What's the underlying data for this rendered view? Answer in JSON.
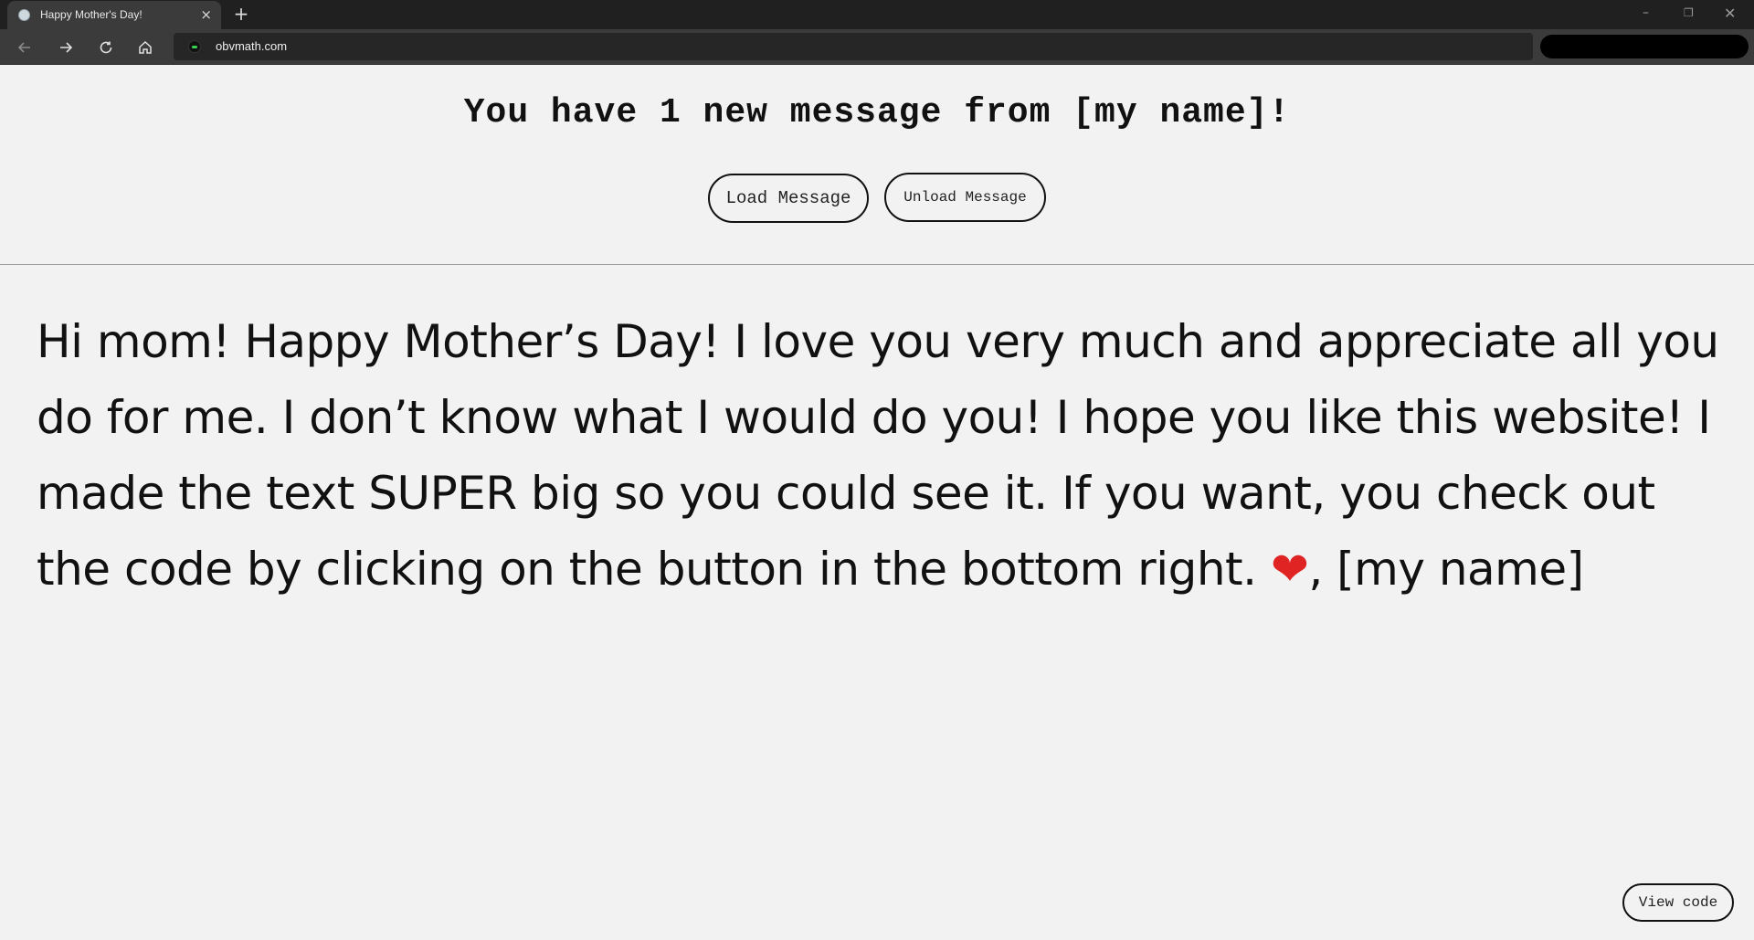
{
  "browser": {
    "tab_title": "Happy Mother's Day!",
    "tab_close": "×",
    "new_tab": "+",
    "url": "obvmath.com",
    "window_controls": {
      "minimize": "–",
      "maximize": "❐",
      "close": "✕"
    }
  },
  "page": {
    "headline": "You have 1 new message from [my name]!",
    "load_button": "Load Message",
    "unload_button": "Unload Message",
    "message_text": "Hi mom! Happy Mother’s Day! I love you very much and appreciate all you do for me. I don’t know what I would do you! I hope you like this website! I made the text SUPER big so you could see it. If you want, you check out the code by clicking on the button in the bottom right.",
    "heart": "❤",
    "signature": ", [my name]",
    "view_code_button": "View code"
  },
  "colors": {
    "heart": "#e02424",
    "background": "#f2f2f2",
    "chrome_dark": "#202020"
  },
  "icons": [
    "back-arrow-icon",
    "forward-arrow-icon",
    "reload-icon",
    "home-icon",
    "site-favicon-icon",
    "heart-icon"
  ]
}
